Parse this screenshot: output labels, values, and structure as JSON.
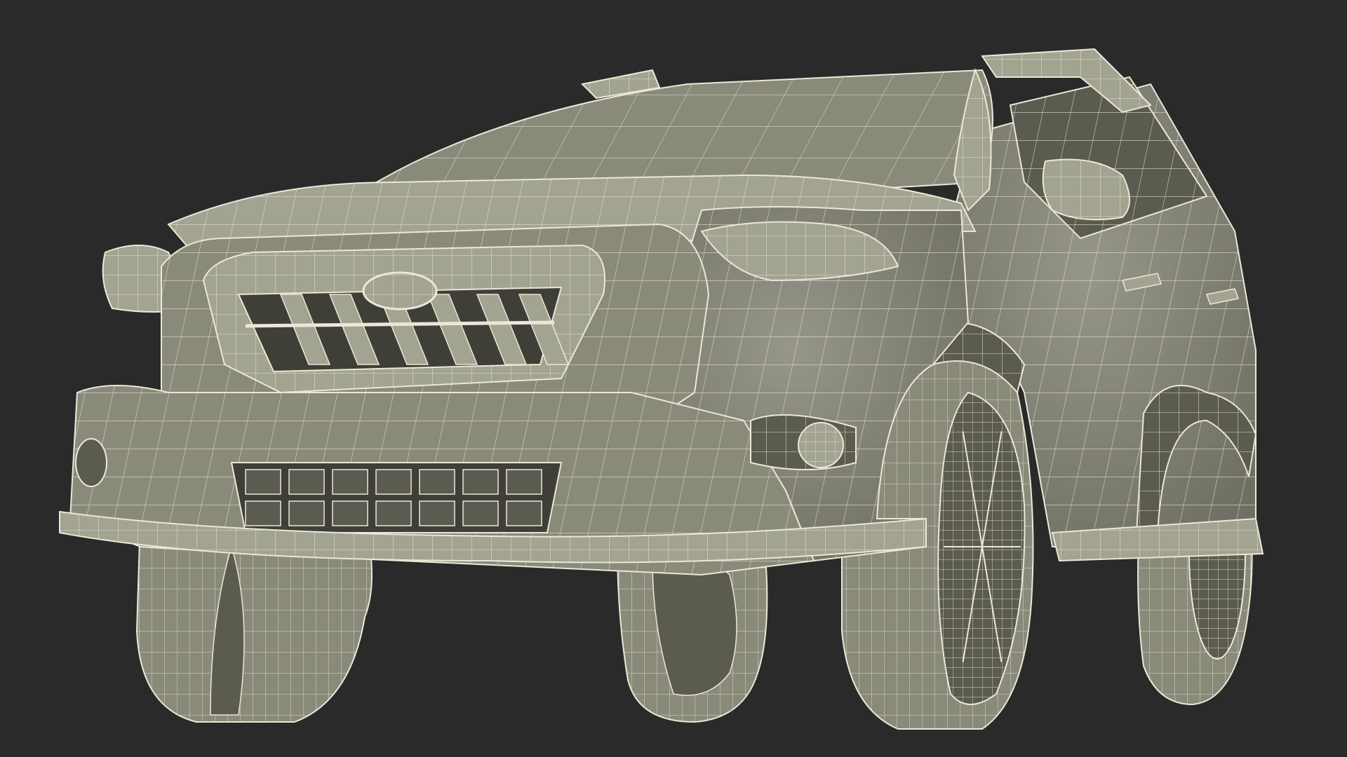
{
  "scene": {
    "subject": "wireframe-suv-front-three-quarter",
    "render_mode": "wireframe-over-clay",
    "colors": {
      "background": "#2a2a2a",
      "surface": "#8a8a7a",
      "surface_dark": "#5b5b50",
      "surface_light": "#a3a392",
      "wire": "#eae8d8",
      "shadow": "#3f3f37"
    }
  }
}
